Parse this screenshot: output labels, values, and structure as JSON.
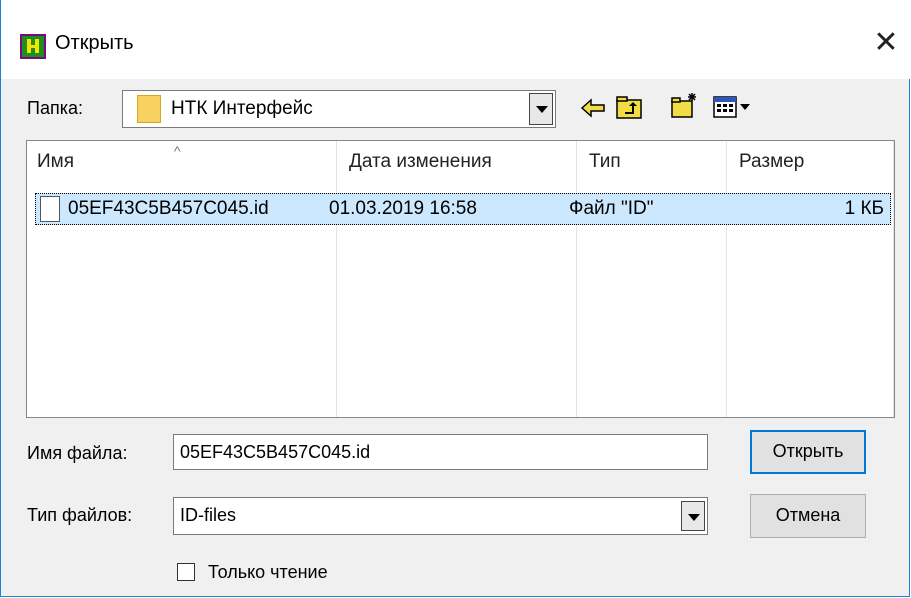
{
  "window": {
    "title": "Открыть",
    "close_label": "✕"
  },
  "toolbar": {
    "folder_label": "Папка:",
    "folder_value": "НТК Интерфейс",
    "icons": [
      "back-arrow-icon",
      "up-folder-icon",
      "new-folder-icon",
      "view-menu-icon"
    ]
  },
  "list": {
    "columns": [
      "Имя",
      "Дата изменения",
      "Тип",
      "Размер"
    ],
    "rows": [
      {
        "name": "05EF43C5B457C045.id",
        "date": "01.03.2019 16:58",
        "type": "Файл \"ID\"",
        "size": "1 КБ"
      }
    ]
  },
  "form": {
    "filename_label": "Имя файла:",
    "filename_value": "05EF43C5B457C045.id",
    "filetype_label": "Тип файлов:",
    "filetype_value": "ID-files",
    "readonly_label": "Только чтение",
    "readonly_checked": false
  },
  "buttons": {
    "open": "Открыть",
    "cancel": "Отмена"
  },
  "colors": {
    "selection": "#cce8ff",
    "window_border": "#1883d7",
    "default_button_border": "#0078d7"
  }
}
